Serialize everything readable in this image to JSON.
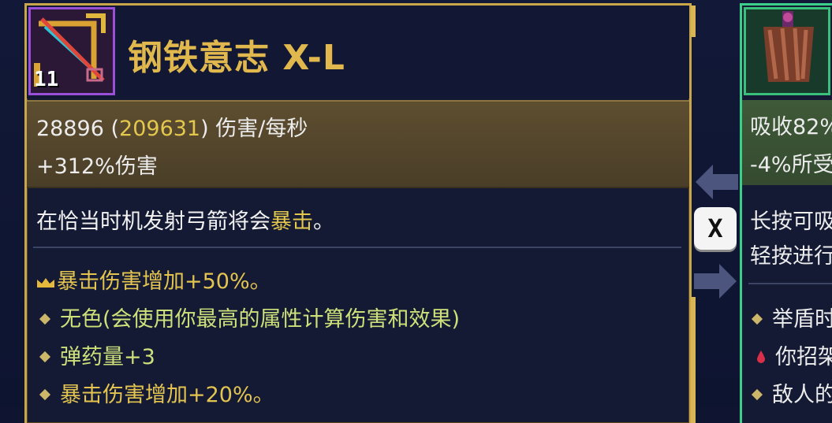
{
  "left_item": {
    "level": "11",
    "title": "钢铁意志 X-L",
    "dps_base": "28896",
    "dps_paren_open": " (",
    "dps_crit": "209631",
    "dps_paren_close": ")",
    "dps_unit": " 伤害/每秒",
    "damage_bonus": "+312%伤害",
    "description_prefix": "在恰当时机发射弓箭将会",
    "description_highlight": "暴击",
    "description_suffix": "。",
    "affixes": [
      {
        "icon": "crown-icon",
        "text": "暴击伤害增加+50%。"
      },
      {
        "icon": "diamond-bullet-icon",
        "text": "无色(会使用你最高的属性计算伤害和效果)"
      },
      {
        "icon": "diamond-bullet-icon",
        "text": "弹药量+3"
      },
      {
        "icon": "diamond-bullet-icon",
        "text": "暴击伤害增加+20%。"
      }
    ]
  },
  "swap": {
    "key_label": "X"
  },
  "right_item": {
    "stat_1": "吸收82%",
    "stat_2": "-4%所受",
    "desc_1": "长按可吸",
    "desc_2": "轻按进行",
    "affixes": [
      {
        "icon": "diamond-bullet-icon",
        "text": "举盾时"
      },
      {
        "icon": "blood-drop-icon",
        "text": "你招架"
      },
      {
        "icon": "diamond-bullet-icon",
        "text": "敌人的"
      }
    ]
  },
  "colors": {
    "gold_border": "#c9a64a",
    "purple_slot": "#9a4fd8",
    "green_border": "#3bd089",
    "yellow_text": "#e4c84e"
  }
}
